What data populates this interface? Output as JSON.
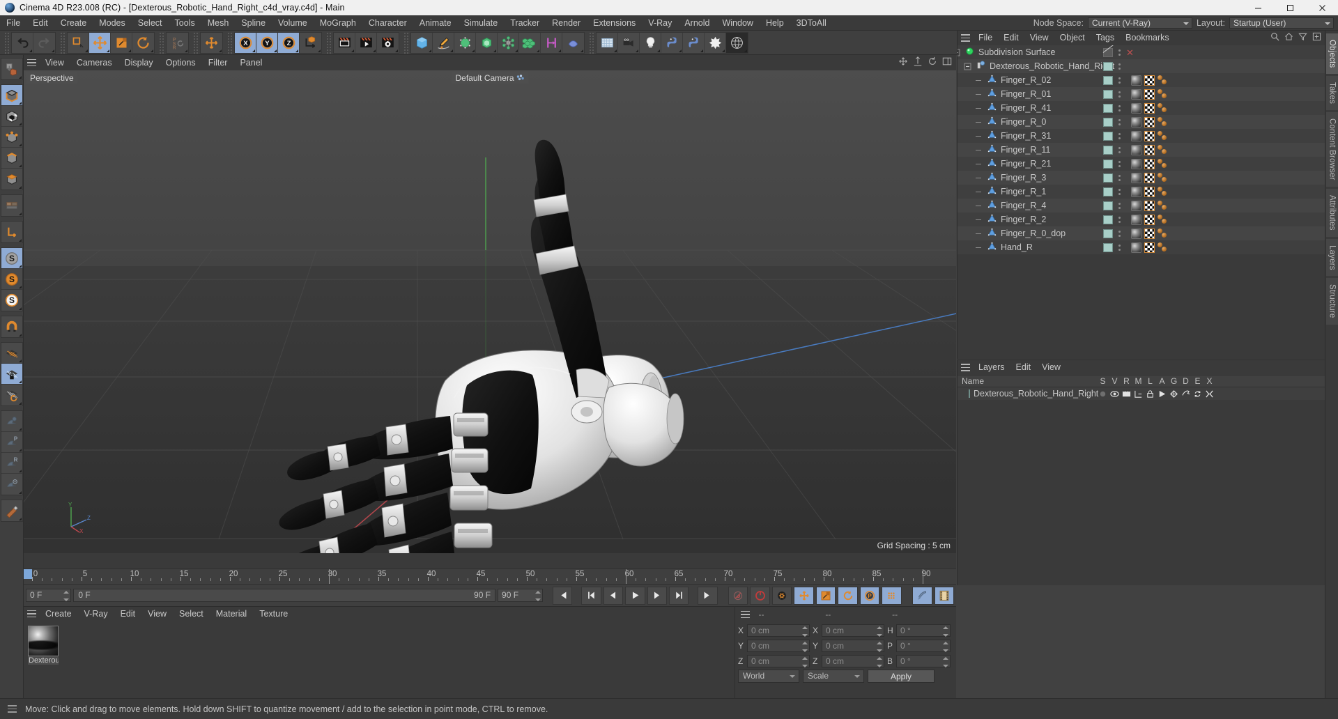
{
  "window": {
    "title": "Cinema 4D R23.008 (RC) - [Dexterous_Robotic_Hand_Right_c4d_vray.c4d] - Main",
    "minimize": "─",
    "maximize": "☐",
    "close": "✕"
  },
  "menubar": {
    "items": [
      "File",
      "Edit",
      "Create",
      "Modes",
      "Select",
      "Tools",
      "Mesh",
      "Spline",
      "Volume",
      "MoGraph",
      "Character",
      "Animate",
      "Simulate",
      "Tracker",
      "Render",
      "Extensions",
      "V-Ray",
      "Arnold",
      "Window",
      "Help",
      "3DToAll"
    ],
    "node_space_label": "Node Space:",
    "node_space_value": "Current (V-Ray)",
    "layout_label": "Layout:",
    "layout_value": "Startup (User)"
  },
  "toolbar": {
    "groups": [
      {
        "name": "history",
        "buttons": [
          {
            "name": "undo-button",
            "icon": "undo",
            "state": "normal"
          },
          {
            "name": "redo-button",
            "icon": "redo",
            "state": "disabled"
          }
        ]
      },
      {
        "name": "transform",
        "buttons": [
          {
            "name": "select-tool-button",
            "icon": "live-selection",
            "state": "normal"
          },
          {
            "name": "move-tool-button",
            "icon": "move",
            "state": "active"
          },
          {
            "name": "scale-tool-button",
            "icon": "scale",
            "state": "normal"
          },
          {
            "name": "rotate-tool-button",
            "icon": "rotate",
            "state": "normal"
          }
        ]
      },
      {
        "name": "psr",
        "buttons": [
          {
            "name": "psr-reset-button",
            "icon": "psr",
            "state": "normal"
          }
        ]
      },
      {
        "name": "world-axis",
        "buttons": [
          {
            "name": "world-coordinate-button",
            "icon": "move-small",
            "state": "normal"
          }
        ]
      },
      {
        "name": "axis-locks",
        "buttons": [
          {
            "name": "lock-x-axis-button",
            "icon": "axis-x",
            "state": "active"
          },
          {
            "name": "lock-y-axis-button",
            "icon": "axis-y",
            "state": "active"
          },
          {
            "name": "lock-z-axis-button",
            "icon": "axis-z",
            "state": "active"
          },
          {
            "name": "world-object-axis-button",
            "icon": "world-axis",
            "state": "normal"
          }
        ]
      },
      {
        "name": "render",
        "buttons": [
          {
            "name": "render-view-button",
            "icon": "render-view",
            "state": "normal"
          },
          {
            "name": "render-queue-button",
            "icon": "render-play",
            "state": "normal"
          },
          {
            "name": "render-settings-button",
            "icon": "render-gear",
            "state": "normal"
          }
        ]
      },
      {
        "name": "primitives",
        "buttons": [
          {
            "name": "add-cube-button",
            "icon": "cube-blue",
            "state": "normal"
          },
          {
            "name": "add-spline-button",
            "icon": "pen-spline",
            "state": "normal"
          },
          {
            "name": "add-generator-button",
            "icon": "nurbs-green",
            "state": "normal"
          },
          {
            "name": "add-subdivision-button",
            "icon": "subdiv-green",
            "state": "normal"
          },
          {
            "name": "add-deformer-button",
            "icon": "deformer-green",
            "state": "normal"
          },
          {
            "name": "add-array-button",
            "icon": "array-green",
            "state": "normal"
          },
          {
            "name": "add-scene-button",
            "icon": "scene-magenta",
            "state": "normal"
          },
          {
            "name": "add-field-button",
            "icon": "field-blue",
            "state": "normal"
          }
        ]
      },
      {
        "name": "scene-objects",
        "buttons": [
          {
            "name": "add-floor-button",
            "icon": "floor",
            "state": "normal"
          },
          {
            "name": "add-camera-button",
            "icon": "camera",
            "state": "normal"
          },
          {
            "name": "add-light-button",
            "icon": "light-bulb",
            "state": "normal"
          },
          {
            "name": "python-scripting-button",
            "icon": "python",
            "state": "normal"
          },
          {
            "name": "python-generator-button",
            "icon": "python2",
            "state": "normal"
          },
          {
            "name": "simulation-button",
            "icon": "gear-star",
            "state": "normal"
          },
          {
            "name": "globe-button",
            "icon": "globe-wire",
            "state": "dark"
          }
        ]
      }
    ]
  },
  "left_toolbar": {
    "buttons": [
      {
        "name": "make-editable-button",
        "icon": "make-editable",
        "state": "normal"
      },
      {
        "name": "model-mode-button",
        "icon": "model-mode",
        "state": "active"
      },
      {
        "name": "texture-mode-button",
        "icon": "texture-mode",
        "state": "normal"
      },
      {
        "name": "points-mode-button",
        "icon": "points-mode",
        "state": "normal"
      },
      {
        "name": "edges-mode-button",
        "icon": "edges-mode",
        "state": "normal"
      },
      {
        "name": "polygons-mode-button",
        "icon": "polygons-mode",
        "state": "normal"
      },
      {
        "name": "uv-mode-button",
        "icon": "uv-mode",
        "state": "normal"
      },
      {
        "name": "axis-mode-button",
        "icon": "axis-mode",
        "state": "normal"
      },
      {
        "name": "enable-axis-button",
        "icon": "s-gray",
        "state": "active"
      },
      {
        "name": "enable-snap-button",
        "icon": "s-orange",
        "state": "normal"
      },
      {
        "name": "enable-quantize-button",
        "icon": "s-white",
        "state": "normal"
      },
      {
        "name": "magnet-tool-button",
        "icon": "magnet",
        "state": "normal"
      },
      {
        "name": "workplane-button",
        "icon": "grid-orange",
        "state": "normal"
      },
      {
        "name": "lock-workplane-button",
        "icon": "grid-lock",
        "state": "active"
      },
      {
        "name": "planar-workplane-button",
        "icon": "grid-rotate",
        "state": "normal"
      },
      {
        "name": "viewport-solo-off-button",
        "icon": "solo-off",
        "state": "normal"
      },
      {
        "name": "viewport-solo-p-button",
        "icon": "solo-p",
        "state": "normal"
      },
      {
        "name": "viewport-solo-r-button",
        "icon": "solo-r",
        "state": "normal"
      },
      {
        "name": "viewport-solo-eye-button",
        "icon": "solo-eye",
        "state": "normal"
      },
      {
        "name": "knife-tool-button",
        "icon": "knife",
        "state": "normal"
      }
    ]
  },
  "viewport": {
    "menu": [
      "View",
      "Cameras",
      "Display",
      "Options",
      "Filter",
      "Panel"
    ],
    "projection_label": "Perspective",
    "camera_label": "Default Camera",
    "grid_spacing": "Grid Spacing : 5 cm",
    "axis_labels": {
      "x": "X",
      "y": "Y",
      "z": "Z"
    },
    "corner_icons": [
      "pan-icon",
      "dolly-icon",
      "rotate-icon",
      "maximize-icon"
    ]
  },
  "timeline": {
    "start_frame": "0 F",
    "current_frame": "0 F",
    "range_start": "0 F",
    "range_end": "90 F",
    "end_frame": "90 F",
    "preview_end": "90 F",
    "ruler_ticks": [
      0,
      5,
      10,
      15,
      20,
      25,
      30,
      35,
      40,
      45,
      50,
      55,
      60,
      65,
      70,
      75,
      80,
      85,
      90
    ],
    "transport": [
      {
        "name": "go-to-start-button",
        "icon": "skip-start"
      },
      {
        "name": "previous-keyframe-button",
        "icon": "prev-key"
      },
      {
        "name": "step-back-button",
        "icon": "step-back"
      },
      {
        "name": "play-button",
        "icon": "play"
      },
      {
        "name": "step-forward-button",
        "icon": "step-fwd"
      },
      {
        "name": "next-keyframe-button",
        "icon": "next-key"
      },
      {
        "name": "go-to-end-button",
        "icon": "skip-end"
      }
    ],
    "record_tools": [
      {
        "name": "autokeying-button",
        "icon": "auto-key",
        "state": "off"
      },
      {
        "name": "record-active-objects-button",
        "icon": "record",
        "state": "off"
      },
      {
        "name": "keyframe-settings-button",
        "icon": "key-gear",
        "state": "off"
      },
      {
        "name": "record-position-button",
        "icon": "key-position",
        "state": "on"
      },
      {
        "name": "record-scale-button",
        "icon": "key-scale",
        "state": "on"
      },
      {
        "name": "record-rotation-button",
        "icon": "key-rotation",
        "state": "on"
      },
      {
        "name": "record-parameter-button",
        "icon": "key-param",
        "state": "on"
      },
      {
        "name": "record-points-button",
        "icon": "key-points",
        "state": "on"
      }
    ],
    "right_tools": [
      {
        "name": "sound-button",
        "icon": "sound"
      },
      {
        "name": "film-strip-button",
        "icon": "film"
      }
    ]
  },
  "material_manager": {
    "menu": [
      "Create",
      "V-Ray",
      "Edit",
      "View",
      "Select",
      "Material",
      "Texture"
    ],
    "materials": [
      {
        "name": "Dexterou",
        "full": "Dexterous_Robotic_Hand_Right"
      }
    ]
  },
  "coordinates": {
    "headers": [
      "--",
      "--",
      "--"
    ],
    "rows": [
      {
        "l1": "X",
        "v1": "0 cm",
        "l2": "X",
        "v2": "0 cm",
        "l3": "H",
        "v3": "0 °"
      },
      {
        "l1": "Y",
        "v1": "0 cm",
        "l2": "Y",
        "v2": "0 cm",
        "l3": "P",
        "v3": "0 °"
      },
      {
        "l1": "Z",
        "v1": "0 cm",
        "l2": "Z",
        "v2": "0 cm",
        "l3": "B",
        "v3": "0 °"
      }
    ],
    "system": "World",
    "mode": "Scale",
    "apply": "Apply"
  },
  "object_manager": {
    "menu": [
      "File",
      "Edit",
      "View",
      "Object",
      "Tags",
      "Bookmarks"
    ],
    "header_icons": [
      "search-icon",
      "home-icon",
      "filter-icon",
      "add-icon"
    ],
    "objects": [
      {
        "name": "Subdivision Surface",
        "type": "subdivision",
        "depth": 0,
        "has_tags": false,
        "swatch": "diag",
        "close": true
      },
      {
        "name": "Dexterous_Robotic_Hand_Right",
        "type": "null",
        "depth": 1,
        "has_tags": false,
        "swatch": "solid"
      },
      {
        "name": "Finger_R_02",
        "type": "polygon",
        "depth": 2,
        "has_tags": true,
        "swatch": "solid"
      },
      {
        "name": "Finger_R_01",
        "type": "polygon",
        "depth": 2,
        "has_tags": true,
        "swatch": "solid"
      },
      {
        "name": "Finger_R_41",
        "type": "polygon",
        "depth": 2,
        "has_tags": true,
        "swatch": "solid"
      },
      {
        "name": "Finger_R_0",
        "type": "polygon",
        "depth": 2,
        "has_tags": true,
        "swatch": "solid"
      },
      {
        "name": "Finger_R_31",
        "type": "polygon",
        "depth": 2,
        "has_tags": true,
        "swatch": "solid"
      },
      {
        "name": "Finger_R_11",
        "type": "polygon",
        "depth": 2,
        "has_tags": true,
        "swatch": "solid"
      },
      {
        "name": "Finger_R_21",
        "type": "polygon",
        "depth": 2,
        "has_tags": true,
        "swatch": "solid"
      },
      {
        "name": "Finger_R_3",
        "type": "polygon",
        "depth": 2,
        "has_tags": true,
        "swatch": "solid"
      },
      {
        "name": "Finger_R_1",
        "type": "polygon",
        "depth": 2,
        "has_tags": true,
        "swatch": "solid"
      },
      {
        "name": "Finger_R_4",
        "type": "polygon",
        "depth": 2,
        "has_tags": true,
        "swatch": "solid"
      },
      {
        "name": "Finger_R_2",
        "type": "polygon",
        "depth": 2,
        "has_tags": true,
        "swatch": "solid"
      },
      {
        "name": "Finger_R_0_dop",
        "type": "polygon",
        "depth": 2,
        "has_tags": true,
        "swatch": "solid"
      },
      {
        "name": "Hand_R",
        "type": "polygon",
        "depth": 2,
        "has_tags": true,
        "swatch": "solid"
      }
    ]
  },
  "layer_manager": {
    "menu": [
      "Layers",
      "Edit",
      "View"
    ],
    "columns": [
      "Name",
      "S",
      "V",
      "R",
      "M",
      "L",
      "A",
      "G",
      "D",
      "E",
      "X"
    ],
    "rows": [
      {
        "name": "Dexterous_Robotic_Hand_Right"
      }
    ]
  },
  "right_dock_tabs": [
    "Objects",
    "Takes",
    "Content Browser",
    "Attributes",
    "Layers",
    "Structure"
  ],
  "statusbar": {
    "message": "Move: Click and drag to move elements. Hold down SHIFT to quantize movement / add to the selection in point mode, CTRL to remove."
  },
  "colors": {
    "accent_orange": "#e08a2e",
    "accent_blue": "#8fabd4",
    "panel_bg": "#3a3a3a",
    "toolbar_bg": "#3f3f3f",
    "text": "#c8c8c8",
    "swatch_teal": "#a8cfc8"
  }
}
